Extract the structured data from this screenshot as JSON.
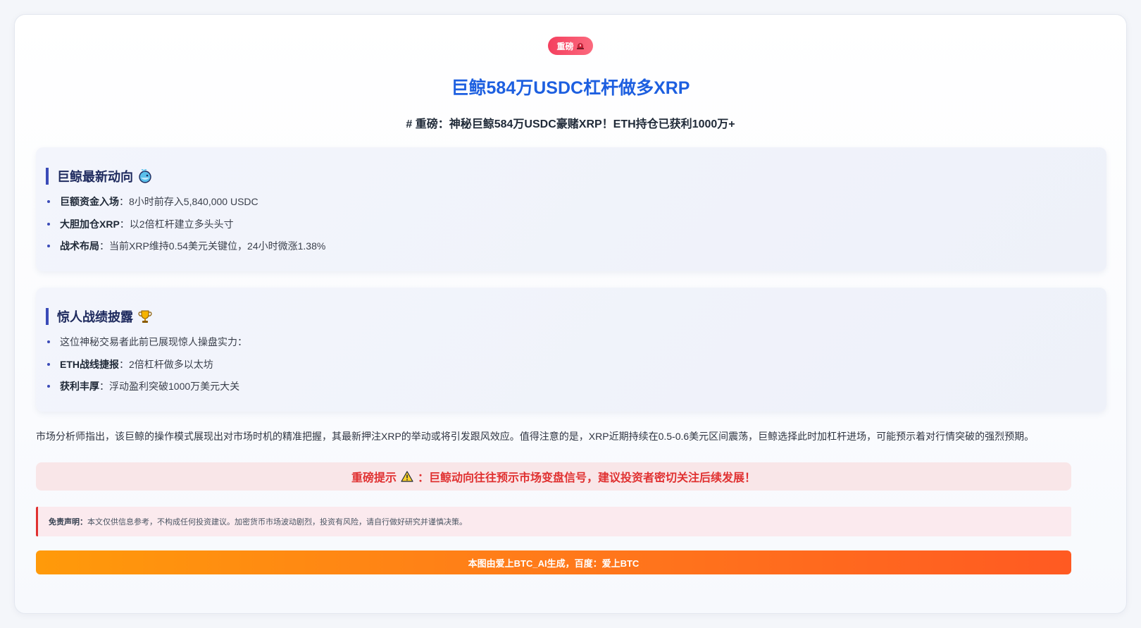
{
  "badge": {
    "label": "重磅"
  },
  "title": "巨鲸584万USDC杠杆做多XRP",
  "subtitle": "# 重磅：神秘巨鲸584万USDC豪赌XRP！ETH持仓已获利1000万+",
  "section1": {
    "heading": "巨鲸最新动向",
    "items": [
      {
        "key": "巨额资金入场",
        "text": "：8小时前存入5,840,000 USDC"
      },
      {
        "key": "大胆加仓XRP",
        "text": "：以2倍杠杆建立多头头寸"
      },
      {
        "key": "战术布局",
        "text": "：当前XRP维持0.54美元关键位，24小时微涨1.38%"
      }
    ]
  },
  "section2": {
    "heading": "惊人战绩披露",
    "intro": "这位神秘交易者此前已展现惊人操盘实力：",
    "items": [
      {
        "key": "ETH战线捷报",
        "text": "：2倍杠杆做多以太坊"
      },
      {
        "key": "获利丰厚",
        "text": "：浮动盈利突破1000万美元大关"
      }
    ]
  },
  "analysis": "市场分析师指出，该巨鲸的操作模式展现出对市场时机的精准把握，其最新押注XRP的举动或将引发跟风效应。值得注意的是，XRP近期持续在0.5-0.6美元区间震荡，巨鲸选择此时加杠杆进场，可能预示着对行情突破的强烈预期。",
  "alert": {
    "prefix": "重磅提示",
    "text": "：巨鲸动向往往预示市场变盘信号，建议投资者密切关注后续发展！"
  },
  "disclaimer": {
    "label": "免责声明：",
    "text": "本文仅供信息参考，不构成任何投资建议。加密货币市场波动剧烈，投资有风险，请自行做好研究并谨慎决策。"
  },
  "footer": "本图由爱上BTC_AI生成，百度：爱上BTC",
  "colors": {
    "title": "#1d5fe0",
    "accent_bar": "#3b4bb8",
    "alert": "#e03131",
    "footer_start": "#ff9a0a",
    "footer_end": "#ff5a22"
  },
  "icons": {
    "badge": "siren-icon",
    "section1": "whale-icon",
    "section2": "trophy-icon",
    "alert": "warning-icon"
  }
}
